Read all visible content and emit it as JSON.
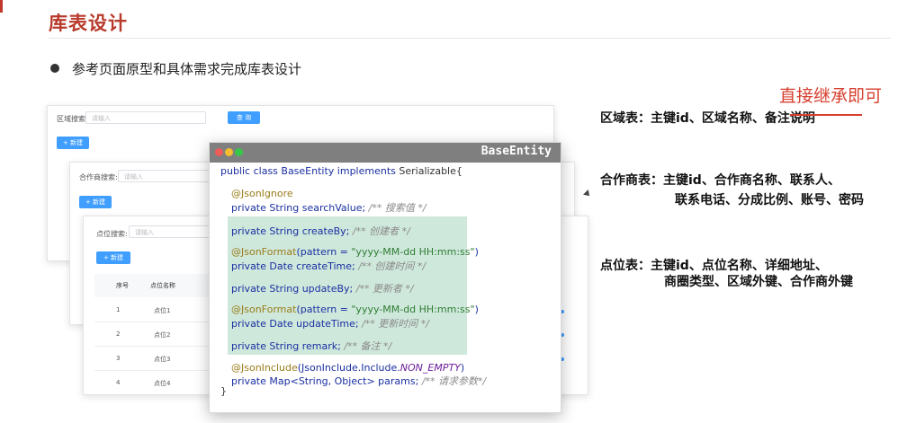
{
  "slide": {
    "title": "库表设计",
    "bullet": "参考页面原型和具体需求完成库表设计"
  },
  "ui_region": {
    "search_label": "区域搜索:",
    "placeholder": "请输入",
    "query_button": "查 询",
    "add_button": "+ 新建"
  },
  "ui_partner": {
    "search_label": "合作商搜索:",
    "placeholder": "请输入",
    "add_button": "+ 新建"
  },
  "ui_node": {
    "search_label": "点位搜索:",
    "placeholder": "请输入",
    "add_button": "+ 新建",
    "columns": [
      "序号",
      "点位名称"
    ],
    "rows": [
      [
        "1",
        "点位1"
      ],
      [
        "2",
        "点位2"
      ],
      [
        "3",
        "点位3"
      ],
      [
        "4",
        "点位4"
      ]
    ]
  },
  "code": {
    "window_title": "BaseEntity",
    "l1_kw": "public class BaseEntity implements",
    "l1_rest": "Serializable{",
    "l2_ann": "@JsonIgnore",
    "l3_code": "private String searchValue;",
    "l3_cmt": "/** 搜索值 */",
    "l4_code": "private String createBy;",
    "l4_cmt": "/** 创建者 */",
    "l5_ann": "@JsonFormat",
    "l5_a": "(pattern = ",
    "l5_str": "\"yyyy-MM-dd HH:mm:ss\"",
    "l5_b": ")",
    "l6_code": "private Date createTime;",
    "l6_cmt": "/** 创建时间 */",
    "l7_code": "private String updateBy;",
    "l7_cmt": "/** 更新者 */",
    "l8_ann": "@JsonFormat",
    "l8_a": "(pattern = ",
    "l8_str": "\"yyyy-MM-dd HH:mm:ss\"",
    "l8_b": ")",
    "l9_code": "private Date updateTime;",
    "l9_cmt": "/** 更新时间 */",
    "l10_code": "private String remark;",
    "l10_cmt": "/** 备注 */",
    "l11_ann": "@JsonInclude",
    "l11_a": "(JsonInclude.Include.",
    "l11_const": "NON_EMPTY",
    "l11_b": ")",
    "l12_code": "private Map<String, Object> params;",
    "l12_cmt": "/** 请求参数*/",
    "l13": "}"
  },
  "notes": {
    "handwritten": "直接继承即可",
    "region": "区域表：主键id、区域名称、备注说明",
    "partner_line1": "合作商表：主键id、合作商名称、联系人、",
    "partner_line2": "联系电话、分成比例、账号、密码",
    "node_line1": "点位表：主键id、点位名称、详细地址、",
    "node_line2": "商圈类型、区域外键、合作商外键"
  },
  "colors": {
    "title": "#b83a2b",
    "accent_blue": "#409eff",
    "annotation_red": "#d64030",
    "code_highlight": "#cfe8dc"
  }
}
